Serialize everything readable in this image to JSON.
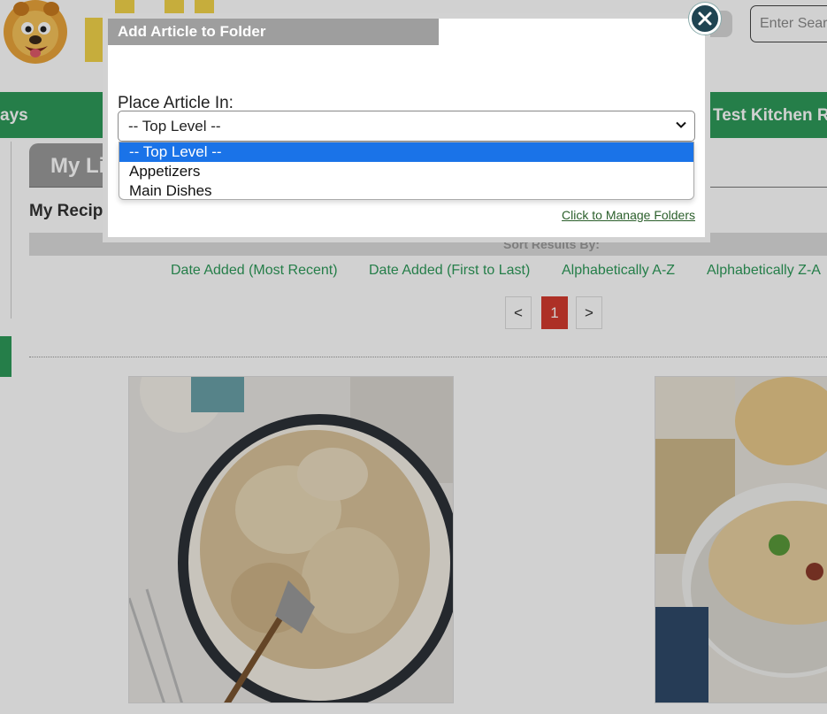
{
  "header": {
    "search_placeholder": "Enter Search"
  },
  "nav": {
    "left_item": "ays",
    "right_item": "Test Kitchen Re"
  },
  "library": {
    "tab_label": "My Li",
    "section_heading": "My Recip"
  },
  "sort": {
    "label": "Sort Results By:",
    "options": [
      "Date Added (Most Recent)",
      "Date Added (First to Last)",
      "Alphabetically A-Z",
      "Alphabetically Z-A"
    ]
  },
  "pagination": {
    "prev": "<",
    "current": "1",
    "next": ">"
  },
  "modal": {
    "title": "Add Article to Folder",
    "field_label": "Place Article In:",
    "selected_value": "-- Top Level --",
    "options": [
      "-- Top Level --",
      "Appetizers",
      "Main Dishes"
    ],
    "manage_link": "Click to Manage Folders"
  },
  "colors": {
    "brand_green": "#2e9a5a",
    "dropdown_highlight": "#1a73e8",
    "active_page": "#d43b2f",
    "modal_header": "#9e9e9e",
    "close_button": "#1f4452"
  }
}
